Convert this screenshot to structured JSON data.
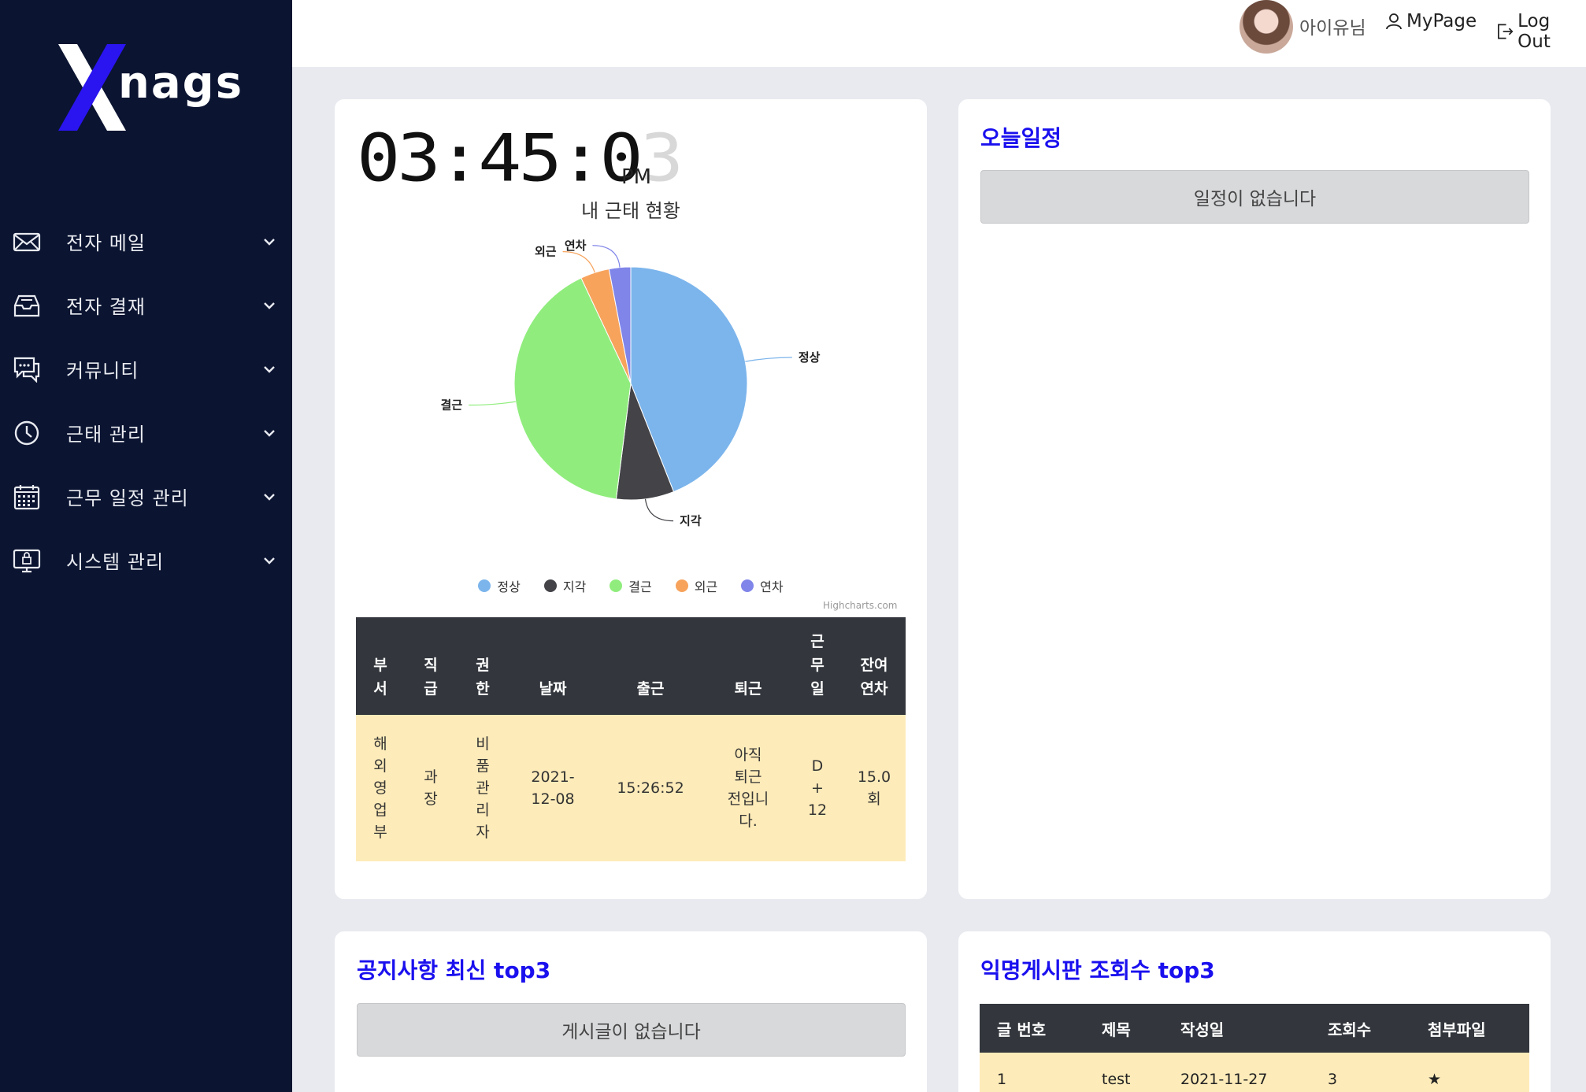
{
  "brand": {
    "logo_text": "nags",
    "logo_mark": "X"
  },
  "sidebar": {
    "items": [
      {
        "label": "전자 메일",
        "icon": "mail-icon"
      },
      {
        "label": "전자 결재",
        "icon": "inbox-tray-icon"
      },
      {
        "label": "커뮤니티",
        "icon": "chat-bubbles-icon"
      },
      {
        "label": "근태 관리",
        "icon": "clock-icon"
      },
      {
        "label": "근무 일정 관리",
        "icon": "calendar-icon"
      },
      {
        "label": "시스템 관리",
        "icon": "monitor-lock-icon"
      }
    ]
  },
  "header": {
    "username": "아이유님",
    "mypage": "MyPage",
    "logout": "Log Out"
  },
  "clock": {
    "hh": "03",
    "mm": "45",
    "ss_first": "0",
    "ss_second": "3",
    "ampm": "PM"
  },
  "attendance": {
    "title": "내 근태 현황",
    "credits": "Highcharts.com",
    "headers": [
      "부\n서",
      "직\n급",
      "권\n한",
      "날짜",
      "출근",
      "퇴근",
      "근\n무\n일",
      "잔여\n연차"
    ],
    "row": [
      "해\n외\n영\n업\n부",
      "과\n장",
      "비\n품\n관\n리\n자",
      "2021-\n12-08",
      "15:26:52",
      "아직\n퇴근\n전입니\n다.",
      "D\n+\n12",
      "15.0\n회"
    ]
  },
  "chart_data": {
    "type": "pie",
    "title": "내 근태 현황",
    "series": [
      {
        "name": "정상",
        "value": 44,
        "color": "#7cb5ec"
      },
      {
        "name": "지각",
        "value": 8,
        "color": "#434348"
      },
      {
        "name": "결근",
        "value": 41,
        "color": "#90ed7d"
      },
      {
        "name": "외근",
        "value": 4,
        "color": "#f7a35c"
      },
      {
        "name": "연차",
        "value": 3,
        "color": "#8085e9"
      }
    ],
    "legend_placement": "bottom"
  },
  "schedule": {
    "title": "오늘일정",
    "empty": "일정이 없습니다"
  },
  "notice": {
    "title": "공지사항 최신 top3",
    "empty": "게시글이 없습니다"
  },
  "anon": {
    "title": "익명게시판 조회수 top3",
    "headers": [
      "글 번호",
      "제목",
      "작성일",
      "조회수",
      "첨부파일"
    ],
    "rows": [
      [
        "1",
        "test",
        "2021-11-27",
        "3",
        "★"
      ]
    ]
  }
}
